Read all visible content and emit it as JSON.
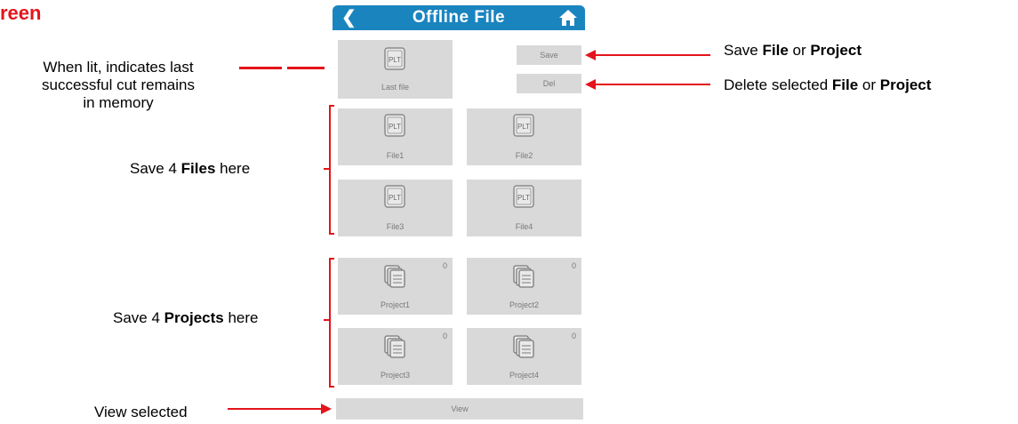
{
  "heading": "reen",
  "app": {
    "title": "Offline File",
    "back_icon": "chevron-left-icon",
    "home_icon": "home-icon",
    "accent": "#1a84bf"
  },
  "last_file": {
    "badge": "PLT",
    "label": "Last file"
  },
  "actions": {
    "save": "Save",
    "del": "Del",
    "view": "View"
  },
  "files": [
    {
      "badge": "PLT",
      "label": "File1"
    },
    {
      "badge": "PLT",
      "label": "File2"
    },
    {
      "badge": "PLT",
      "label": "File3"
    },
    {
      "badge": "PLT",
      "label": "File4"
    }
  ],
  "projects": [
    {
      "label": "Project1",
      "count": "0"
    },
    {
      "label": "Project2",
      "count": "0"
    },
    {
      "label": "Project3",
      "count": "0"
    },
    {
      "label": "Project4",
      "count": "0"
    }
  ],
  "annotations": {
    "last_file_note": [
      "When lit,  indicates last",
      "successful cut remains",
      "in memory"
    ],
    "save_note": {
      "prefix": "Save ",
      "b1": "File",
      "mid": " or ",
      "b2": "Project"
    },
    "del_note": {
      "prefix": "Delete selected  ",
      "b1": "File",
      "mid": " or ",
      "b2": "Project"
    },
    "files_note": {
      "prefix": "Save 4  ",
      "b": "Files",
      "suffix": " here"
    },
    "projects_note": {
      "prefix": "Save 4  ",
      "b": "Projects",
      "suffix": " here"
    },
    "view_note": "View selected"
  },
  "colors": {
    "annotation_red": "#e4141b",
    "tile_gray": "#d9d9d9"
  }
}
